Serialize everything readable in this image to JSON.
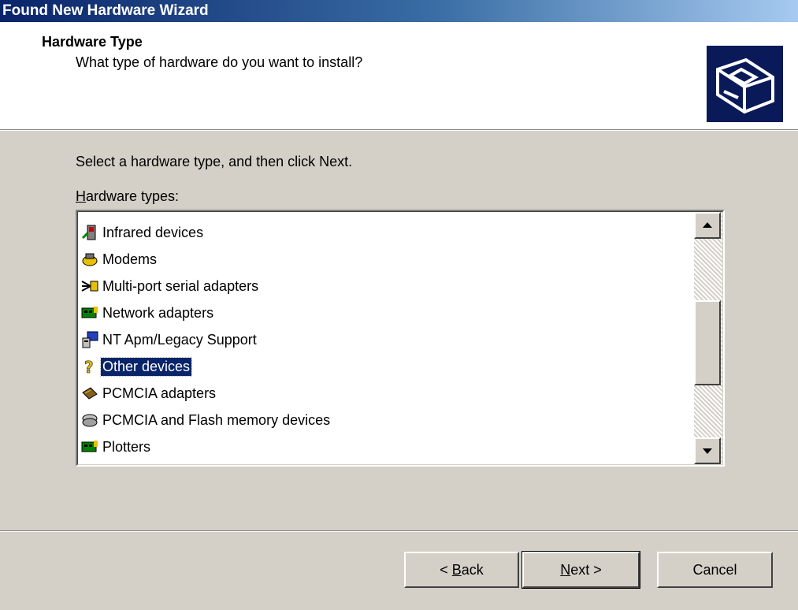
{
  "window": {
    "title": "Found New Hardware Wizard"
  },
  "header": {
    "title": "Hardware Type",
    "subtitle": "What type of hardware do you want to install?",
    "icon": "hardware-card-icon"
  },
  "body": {
    "instruction": "Select a hardware type, and then click Next.",
    "list_label_prefix": "",
    "list_label_accel": "H",
    "list_label_rest": "ardware types:"
  },
  "list": {
    "items": [
      {
        "label": "Infrared devices",
        "icon": "infrared-icon"
      },
      {
        "label": "Modems",
        "icon": "modem-icon"
      },
      {
        "label": "Multi-port serial adapters",
        "icon": "serial-adapter-icon"
      },
      {
        "label": "Network adapters",
        "icon": "network-adapter-icon"
      },
      {
        "label": "NT Apm/Legacy Support",
        "icon": "computer-icon"
      },
      {
        "label": "Other devices",
        "icon": "question-icon",
        "selected": true
      },
      {
        "label": "PCMCIA adapters",
        "icon": "pcmcia-adapter-icon"
      },
      {
        "label": "PCMCIA and Flash memory devices",
        "icon": "flash-memory-icon"
      },
      {
        "label": "Plotters",
        "icon": "plotter-icon"
      }
    ],
    "selected_index": 5
  },
  "buttons": {
    "back_pre": "< ",
    "back_accel": "B",
    "back_rest": "ack",
    "next_accel": "N",
    "next_rest": "ext >",
    "cancel": "Cancel"
  },
  "colors": {
    "selection": "#0a246a",
    "face": "#d4d0c8",
    "title_start": "#0a246a",
    "title_end": "#a6caf0"
  }
}
